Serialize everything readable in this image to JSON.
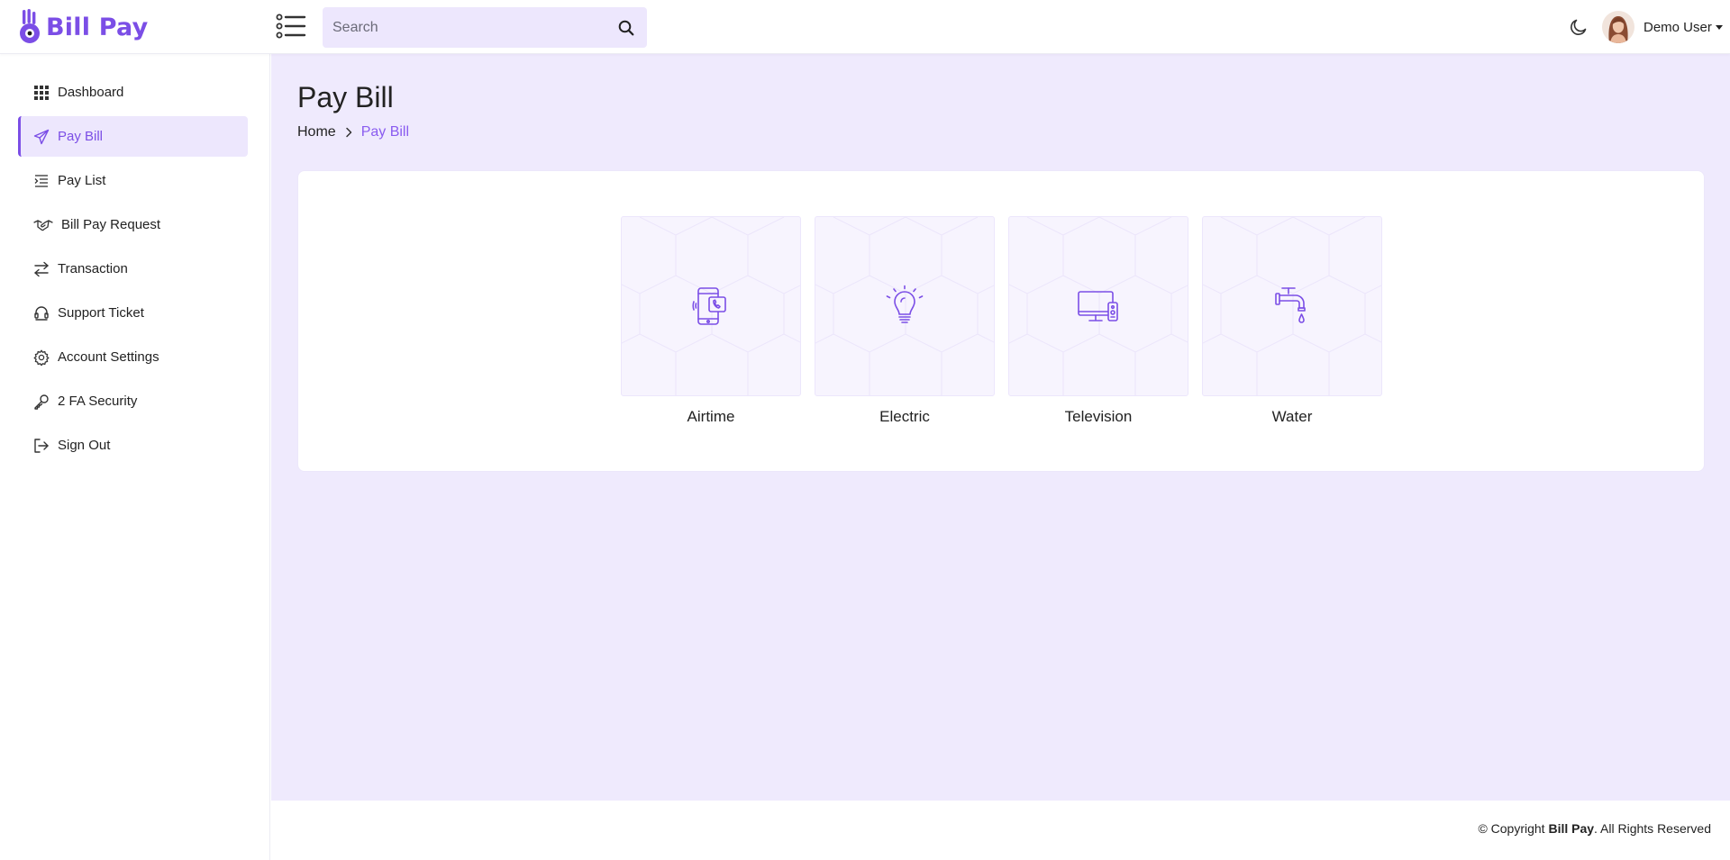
{
  "header": {
    "logo_text": "Bill Pay",
    "search_placeholder": "Search",
    "user_name": "Demo User"
  },
  "sidebar": {
    "items": [
      {
        "label": "Dashboard",
        "icon": "grid-icon"
      },
      {
        "label": "Pay Bill",
        "icon": "send-icon",
        "active": true
      },
      {
        "label": "Pay List",
        "icon": "list-icon"
      },
      {
        "label": "Bill Pay Request",
        "icon": "handshake-icon"
      },
      {
        "label": "Transaction",
        "icon": "arrows-exchange-icon"
      },
      {
        "label": "Support Ticket",
        "icon": "headset-icon"
      },
      {
        "label": "Account Settings",
        "icon": "gear-icon"
      },
      {
        "label": "2 FA Security",
        "icon": "key-icon"
      },
      {
        "label": "Sign Out",
        "icon": "sign-out-icon"
      }
    ]
  },
  "main": {
    "title": "Pay Bill",
    "breadcrumb": {
      "home": "Home",
      "current": "Pay Bill"
    },
    "tiles": [
      {
        "label": "Airtime",
        "icon": "phone-call-icon"
      },
      {
        "label": "Electric",
        "icon": "light-bulb-icon"
      },
      {
        "label": "Television",
        "icon": "tv-remote-icon"
      },
      {
        "label": "Water",
        "icon": "water-tap-icon"
      }
    ]
  },
  "footer": {
    "prefix": "© Copyright ",
    "brand": "Bill Pay",
    "suffix": ". All Rights Reserved"
  },
  "colors": {
    "accent": "#7b4ee6",
    "main_bg": "#efeafd",
    "active_bg": "#ede7fd"
  }
}
